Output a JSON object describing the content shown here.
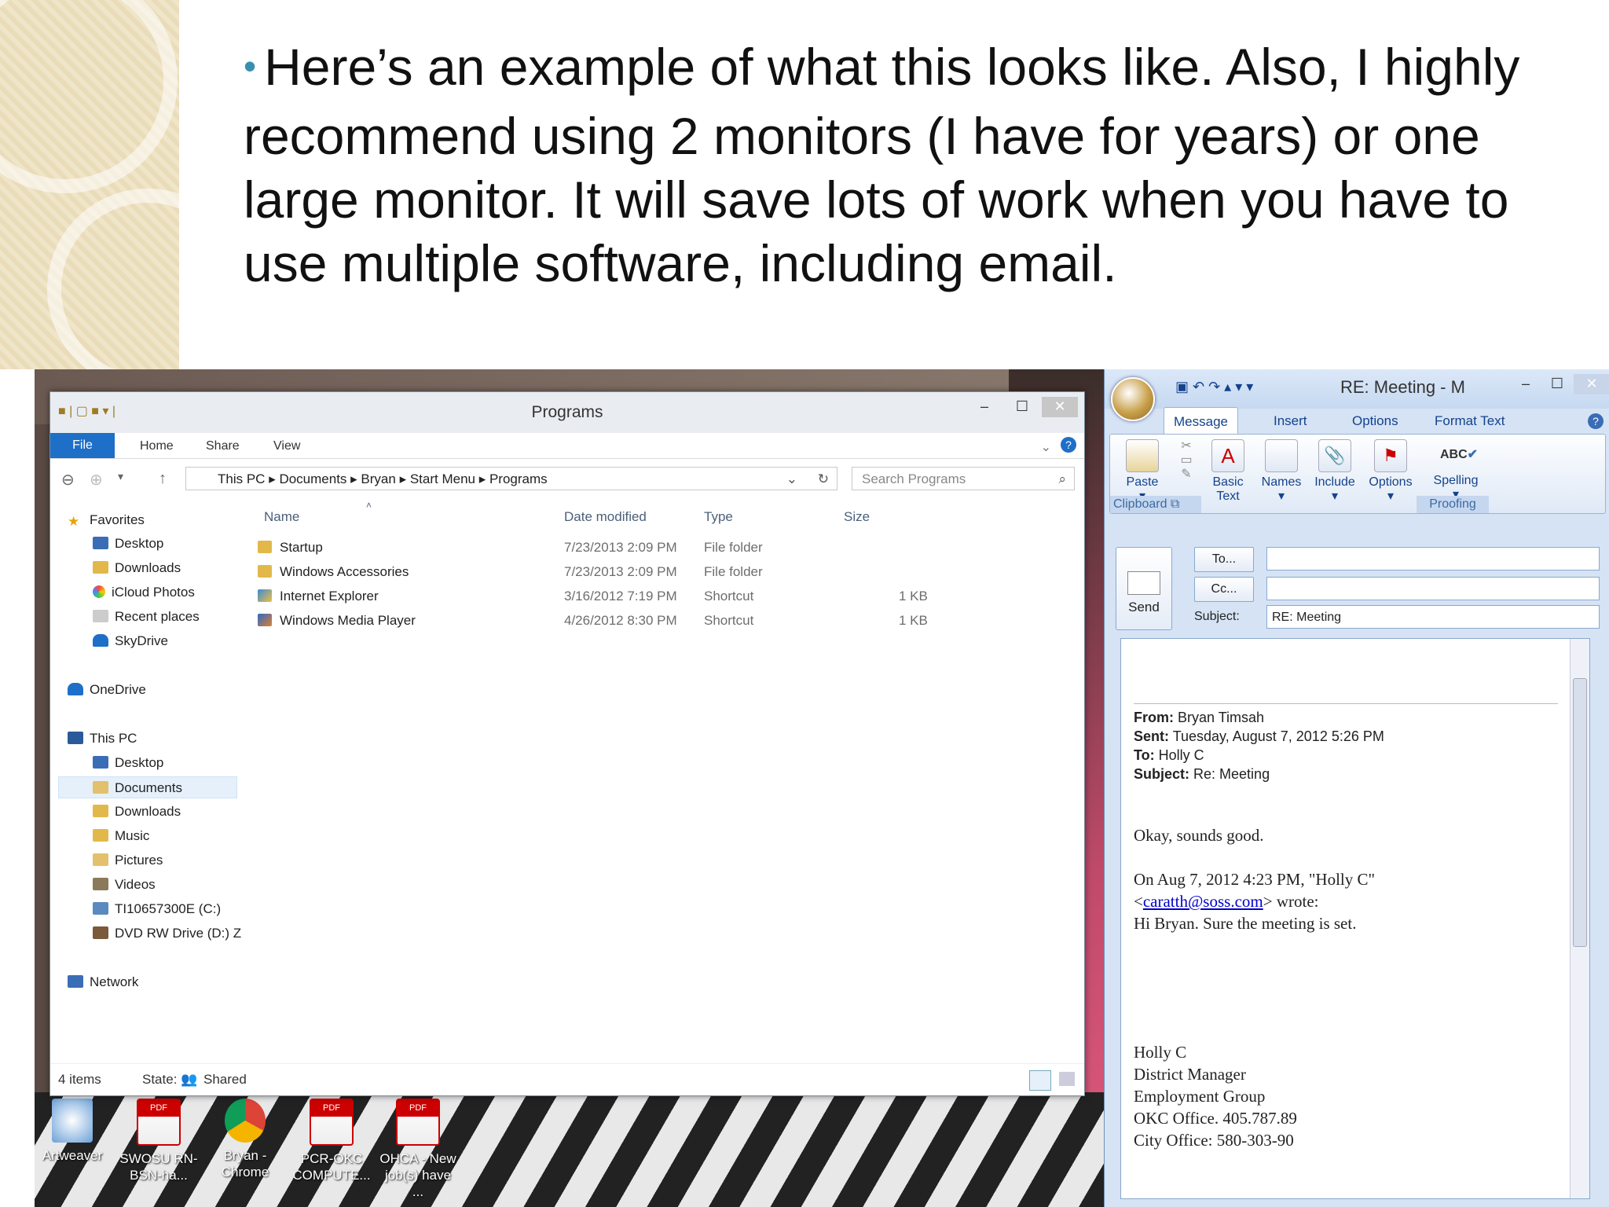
{
  "slide": {
    "bullet": "•",
    "text": "Here’s an example of what this looks like.  Also, I highly recommend using 2 monitors (I have for years) or one large monitor. It will save lots of work when you have to use multiple software, including email."
  },
  "desktop_icons": [
    {
      "label": "Artweaver",
      "icon": "artweaver-icon"
    },
    {
      "label": "SWOSU RN-BSN-ha...",
      "icon": "pdf-icon"
    },
    {
      "label": "Bryan - Chrome",
      "icon": "chrome-icon"
    },
    {
      "label": "PCR-OKC COMPUTE...",
      "icon": "pdf-icon"
    },
    {
      "label": "OHCA - New job(s) have ...",
      "icon": "pdf-icon"
    }
  ],
  "explorer": {
    "title": "Programs",
    "ribbon_tabs": [
      "File",
      "Home",
      "Share",
      "View"
    ],
    "breadcrumb": [
      "This PC",
      "Documents",
      "Bryan",
      "Start Menu",
      "Programs"
    ],
    "search_placeholder": "Search Programs",
    "nav": {
      "favorites_label": "Favorites",
      "favorites": [
        "Desktop",
        "Downloads",
        "iCloud Photos",
        "Recent places",
        "SkyDrive"
      ],
      "onedrive": "OneDrive",
      "thispc_label": "This PC",
      "thispc": [
        "Desktop",
        "Documents",
        "Downloads",
        "Music",
        "Pictures",
        "Videos",
        "TI10657300E (C:)",
        "DVD RW Drive (D:) Z"
      ],
      "network": "Network"
    },
    "columns": [
      "Name",
      "Date modified",
      "Type",
      "Size"
    ],
    "files": [
      {
        "name": "Startup",
        "date": "7/23/2013 2:09 PM",
        "type": "File folder",
        "size": ""
      },
      {
        "name": "Windows Accessories",
        "date": "7/23/2013 2:09 PM",
        "type": "File folder",
        "size": ""
      },
      {
        "name": "Internet Explorer",
        "date": "3/16/2012 7:19 PM",
        "type": "Shortcut",
        "size": "1 KB"
      },
      {
        "name": "Windows Media Player",
        "date": "4/26/2012 8:30 PM",
        "type": "Shortcut",
        "size": "1 KB"
      }
    ],
    "status": {
      "items": "4 items",
      "state_label": "State:",
      "state": "Shared"
    }
  },
  "outlook": {
    "title": "RE: Meeting - M",
    "tabs": [
      "Message",
      "Insert",
      "Options",
      "Format Text"
    ],
    "ribbon": {
      "paste": "Paste",
      "basic_text": "Basic Text",
      "names": "Names",
      "include": "Include",
      "options": "Options",
      "spelling": "Spelling",
      "group_clipboard": "Clipboard",
      "group_proofing": "Proofing",
      "abc": "ABC"
    },
    "send": "Send",
    "to_button": "To...",
    "cc_button": "Cc...",
    "subject_label": "Subject:",
    "subject_value": "RE: Meeting",
    "body": {
      "from_label": "From:",
      "from": "Bryan Timsah",
      "sent_label": "Sent:",
      "sent": "Tuesday, August 7, 2012 5:26 PM",
      "to_label": "To:",
      "to": "Holly C",
      "subject_label": "Subject:",
      "subject": "Re: Meeting",
      "line1": "Okay, sounds good.",
      "line2": "On Aug 7, 2012 4:23 PM, \"Holly C\"",
      "email_open": "<",
      "email": "caratth@soss.com",
      "email_close": "> wrote:",
      "line3": "Hi Bryan.  Sure the meeting is set.",
      "sig": [
        "Holly C",
        "District Manager",
        "Employment Group",
        "OKC Office. 405.787.89",
        "City Office:  580-303-90"
      ]
    }
  }
}
